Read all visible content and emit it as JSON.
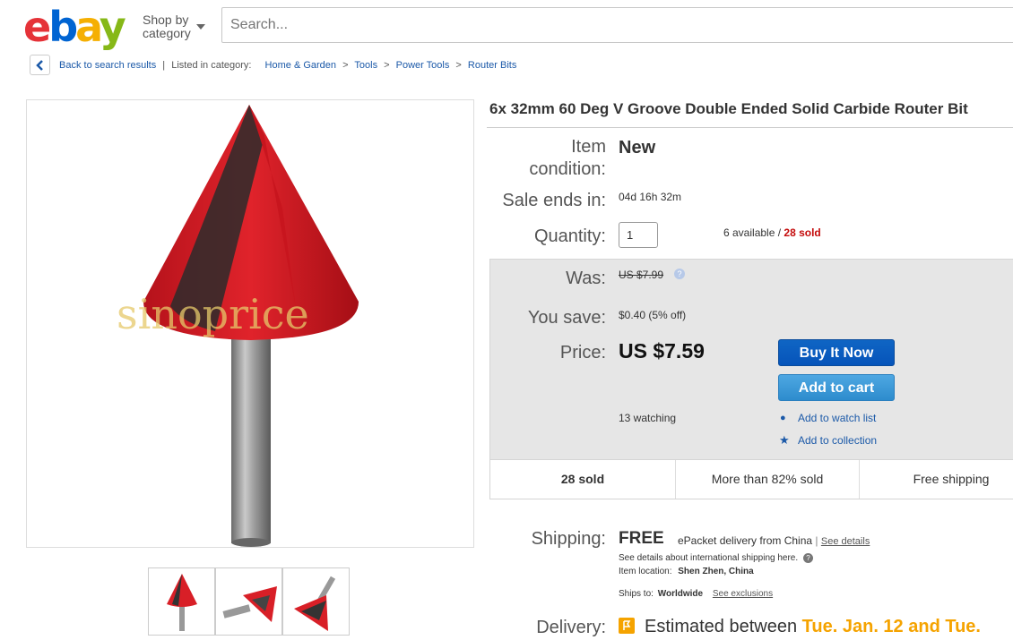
{
  "header": {
    "logo": {
      "e": "e",
      "b": "b",
      "a": "a",
      "y": "y"
    },
    "shop_by_line1": "Shop by",
    "shop_by_line2": "category",
    "search_placeholder": "Search..."
  },
  "breadcrumb": {
    "back": "Back to search results",
    "listed": "Listed in category:",
    "items": [
      "Home & Garden",
      "Tools",
      "Power Tools",
      "Router Bits"
    ]
  },
  "image": {
    "watermark": "sinoprice"
  },
  "listing": {
    "title": "6x 32mm 60 Deg V Groove Double Ended Solid Carbide Router Bit",
    "condition_label_1": "Item",
    "condition_label_2": "condition:",
    "condition_value": "New",
    "sale_ends_label": "Sale ends in:",
    "sale_ends_value": "04d 16h 32m",
    "quantity_label": "Quantity:",
    "quantity_value": "1",
    "available": "6 available",
    "slash": " / ",
    "sold": "28 sold",
    "was_label": "Was:",
    "was_value": "US $7.99",
    "save_label": "You save:",
    "save_value": "$0.40 (5% off)",
    "price_label": "Price:",
    "price_value": "US $7.59",
    "buy_now": "Buy It Now",
    "add_to_cart": "Add to cart",
    "watching": "13 watching",
    "add_watch": "Add to watch list",
    "add_collection": "Add to collection",
    "stats": [
      "28 sold",
      "More than 82% sold",
      "Free shipping"
    ],
    "shipping_label": "Shipping:",
    "shipping_value": "FREE",
    "shipping_method": "ePacket delivery from China",
    "pipe": "|",
    "see_details": "See details",
    "intl_note": "See details about international shipping here.",
    "item_location_label": "Item location:",
    "item_location": "Shen Zhen, China",
    "ships_to_label": "Ships to:",
    "ships_to": "Worldwide",
    "see_exclusions": "See exclusions",
    "delivery_label": "Delivery:",
    "delivery_text": "Estimated between",
    "delivery_dates": "Tue. Jan. 12 and Tue."
  },
  "colors": {
    "accent_blue": "#0654ba",
    "sold_red": "#c40a0a",
    "delivery_orange": "#f5a300"
  }
}
